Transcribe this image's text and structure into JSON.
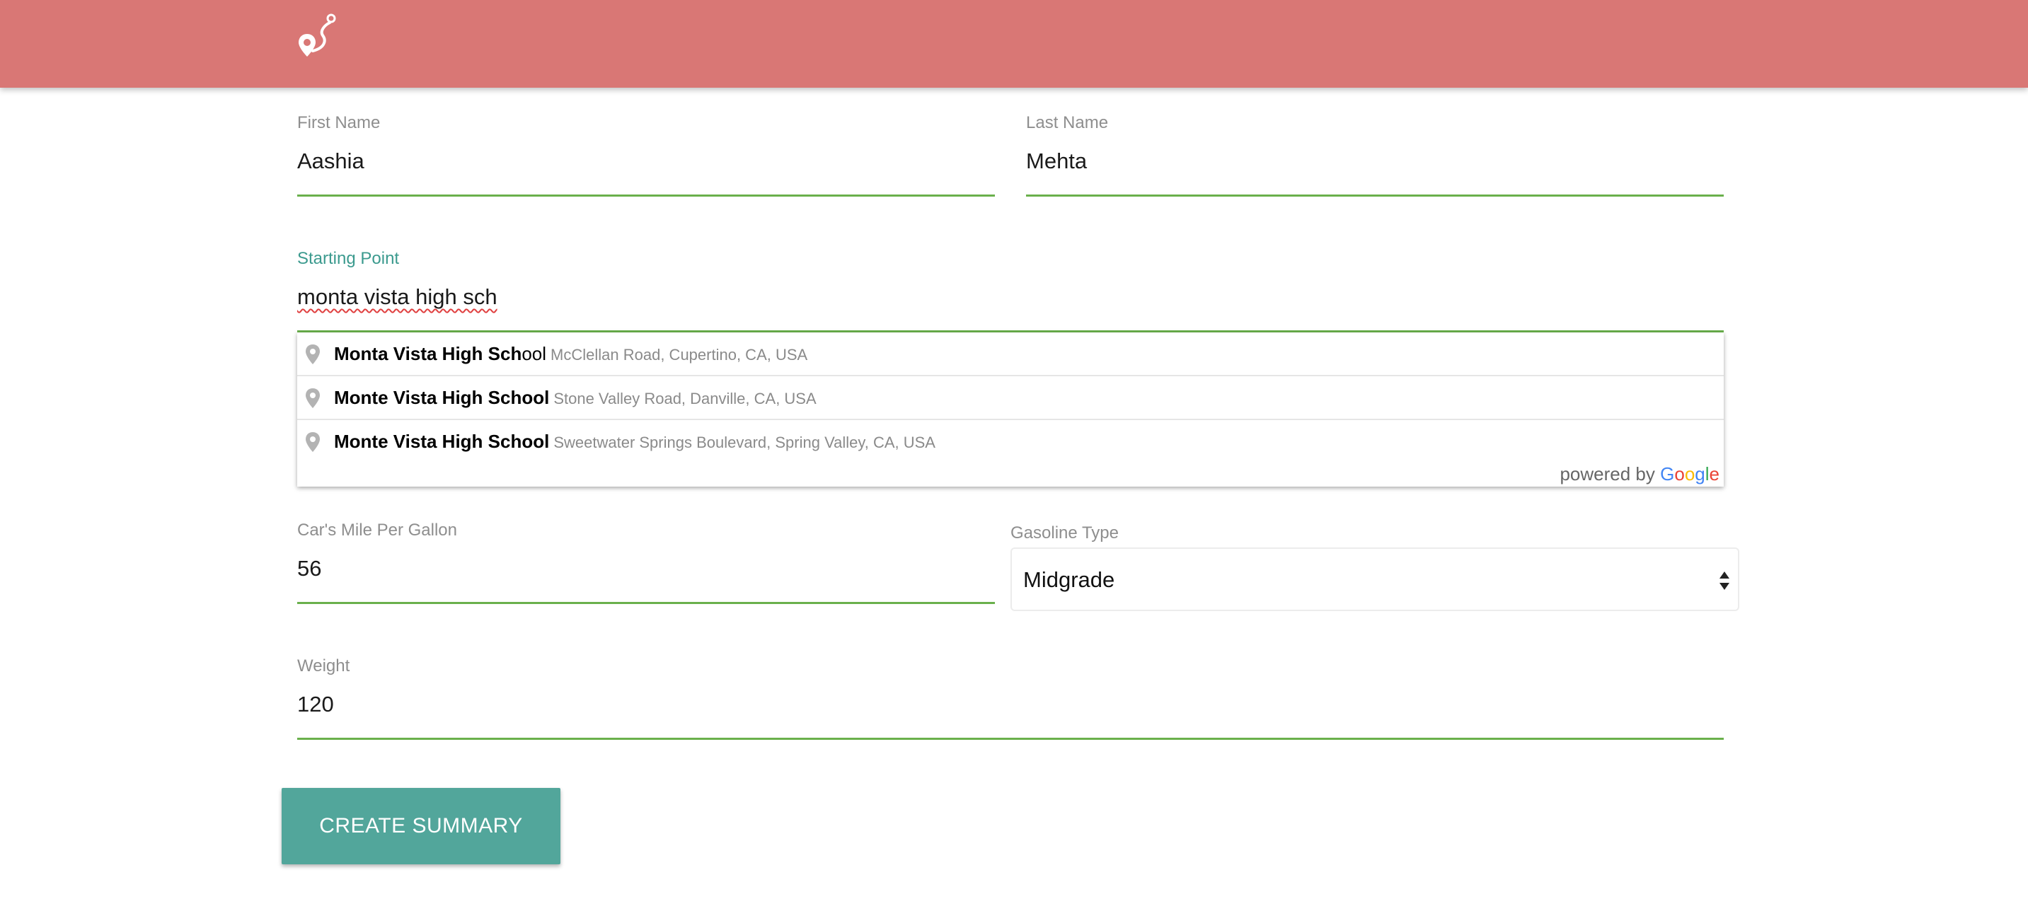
{
  "header": {
    "logo_icon": "pin-path-logo-icon",
    "background_color": "#d97775"
  },
  "form": {
    "first_name": {
      "label": "First Name",
      "value": "Aashia"
    },
    "last_name": {
      "label": "Last Name",
      "value": "Mehta"
    },
    "starting_point": {
      "label": "Starting Point",
      "value": "monta vista high sch"
    },
    "mpg": {
      "label": "Car's Mile Per Gallon",
      "value": "56"
    },
    "gasoline_type": {
      "label": "Gasoline Type",
      "selected": "Midgrade"
    },
    "weight": {
      "label": "Weight",
      "value": "120"
    },
    "submit_label": "CREATE SUMMARY"
  },
  "autocomplete": {
    "suggestions": [
      {
        "match": "Monta Vista High Sch",
        "rest": "ool",
        "secondary": "McClellan Road, Cupertino, CA, USA"
      },
      {
        "match": "Monte Vista High School",
        "rest": "",
        "secondary": "Stone Valley Road, Danville, CA, USA"
      },
      {
        "match": "Monte Vista High School",
        "rest": "",
        "secondary": "Sweetwater Springs Boulevard, Spring Valley, CA, USA"
      }
    ],
    "powered_by": "powered by",
    "brand": "Google"
  },
  "colors": {
    "accent_line": "#6ab04c",
    "button": "#52a69b",
    "active_label": "#3b9a8e"
  }
}
